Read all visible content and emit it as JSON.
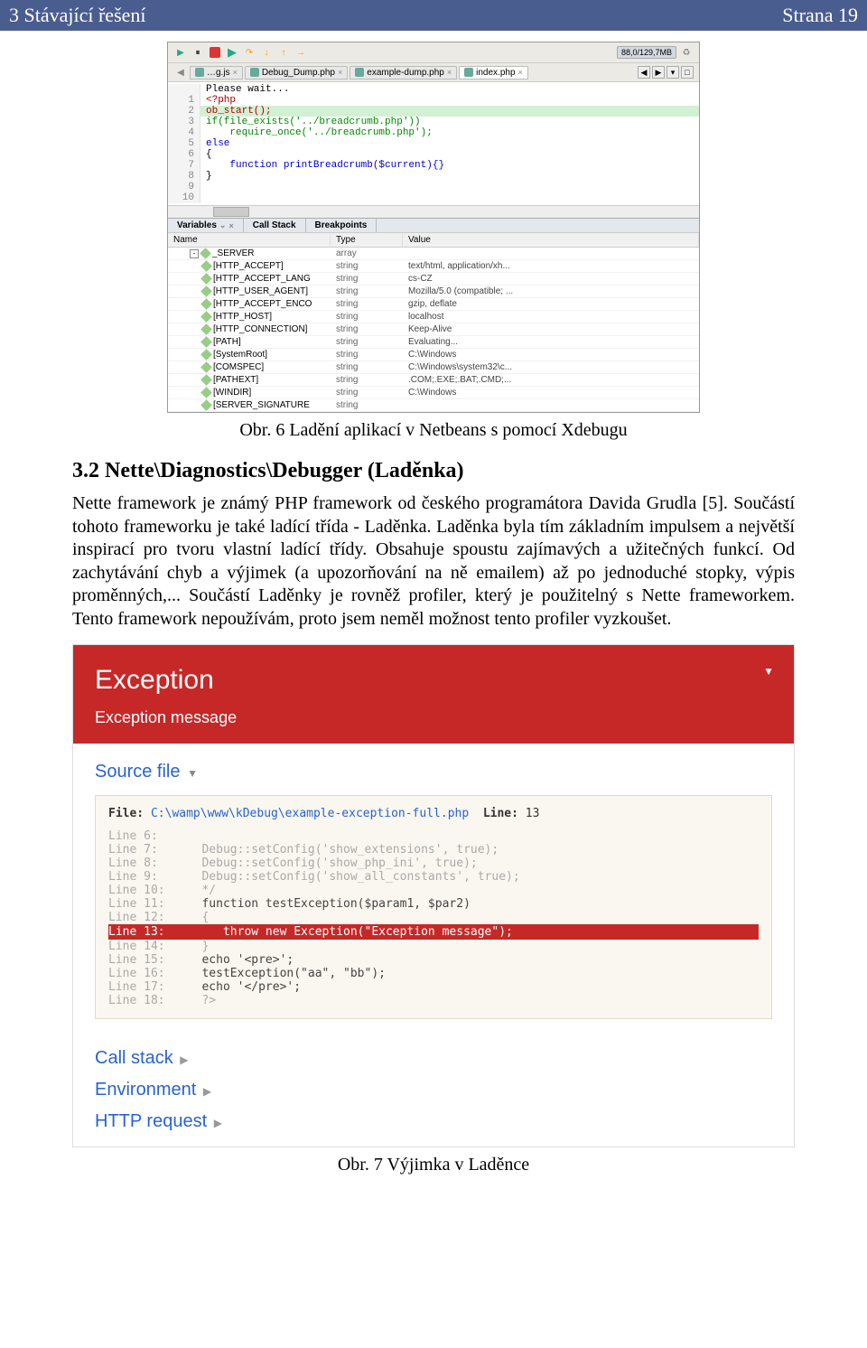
{
  "header": {
    "left": "3  Stávající řešení",
    "right": "Strana 19"
  },
  "netbeans": {
    "memory": "88,0/129,7MB",
    "tabs": [
      "…g.js",
      "Debug_Dump.php",
      "example-dump.php",
      "index.php"
    ],
    "code_lines": [
      {
        "n": "",
        "t": "Please wait..."
      },
      {
        "n": "1",
        "t": "<?php",
        "cls": "kw-red"
      },
      {
        "n": "2",
        "t": "ob_start();",
        "hl": true,
        "cls": "kw-red"
      },
      {
        "n": "3",
        "t": "if(file_exists('../breadcrumb.php'))",
        "cls": "kw-green"
      },
      {
        "n": "4",
        "t": "    require_once('../breadcrumb.php');",
        "cls": "kw-green"
      },
      {
        "n": "5",
        "t": "else",
        "cls": "kw-blue"
      },
      {
        "n": "6",
        "t": "{"
      },
      {
        "n": "7",
        "t": "    function printBreadcrumb($current){}",
        "cls": "kw-blue"
      },
      {
        "n": "8",
        "t": "}"
      },
      {
        "n": "9",
        "t": ""
      },
      {
        "n": "10",
        "t": ""
      }
    ],
    "panels": [
      "Variables",
      "Call Stack",
      "Breakpoints"
    ],
    "vars_hdr": {
      "name": "Name",
      "type": "Type",
      "value": "Value"
    },
    "vars": [
      {
        "name": "_SERVER",
        "type": "array",
        "value": "",
        "indent": 1,
        "tree": "-"
      },
      {
        "name": "[HTTP_ACCEPT]",
        "type": "string",
        "value": "text/html, application/xh...",
        "indent": 2
      },
      {
        "name": "[HTTP_ACCEPT_LANG",
        "type": "string",
        "value": "cs-CZ",
        "indent": 2
      },
      {
        "name": "[HTTP_USER_AGENT]",
        "type": "string",
        "value": "Mozilla/5.0 (compatible; ...",
        "indent": 2
      },
      {
        "name": "[HTTP_ACCEPT_ENCO",
        "type": "string",
        "value": "gzip, deflate",
        "indent": 2
      },
      {
        "name": "[HTTP_HOST]",
        "type": "string",
        "value": "localhost",
        "indent": 2
      },
      {
        "name": "[HTTP_CONNECTION]",
        "type": "string",
        "value": "Keep-Alive",
        "indent": 2
      },
      {
        "name": "[PATH]",
        "type": "string",
        "value": "Evaluating...",
        "indent": 2
      },
      {
        "name": "[SystemRoot]",
        "type": "string",
        "value": "C:\\Windows",
        "indent": 2
      },
      {
        "name": "[COMSPEC]",
        "type": "string",
        "value": "C:\\Windows\\system32\\c...",
        "indent": 2
      },
      {
        "name": "[PATHEXT]",
        "type": "string",
        "value": ".COM;.EXE;.BAT;.CMD;...",
        "indent": 2
      },
      {
        "name": "[WINDIR]",
        "type": "string",
        "value": "C:\\Windows",
        "indent": 2
      },
      {
        "name": "[SERVER_SIGNATURE",
        "type": "string",
        "value": "",
        "indent": 2
      }
    ]
  },
  "caption1": "Obr. 6 Ladění aplikací v Netbeans s pomocí Xdebugu",
  "section": {
    "num": "3.2",
    "title": "Nette\\Diagnostics\\Debugger (Laděnka)"
  },
  "paragraph": "Nette framework je známý PHP framework od českého programátora Davida Grudla [5]. Součástí tohoto frameworku je také ladící třída - Laděnka. Laděnka byla tím základním impulsem a největší inspirací pro tvoru vlastní ladící třídy. Obsahuje spoustu zajímavých a užitečných funkcí. Od zachytávání chyb a výjimek (a upozorňování na ně emailem) až po jednoduché stopky, výpis proměnných,... Součástí Laděnky je rovněž profiler, který je použitelný s Nette frameworkem. Tento framework nepoužívám, proto jsem neměl možnost tento profiler vyzkoušet.",
  "ladenka": {
    "title": "Exception",
    "message": "Exception message",
    "source_file_label": "Source file",
    "file_label": "File:",
    "file_path": "C:\\wamp\\www\\kDebug\\example-exception-full.php",
    "line_label": "Line:",
    "line_no": "13",
    "lines": [
      {
        "n": "Line  6:",
        "t": ""
      },
      {
        "n": "Line  7:",
        "t": "   Debug::setConfig('show_extensions', true);"
      },
      {
        "n": "Line  8:",
        "t": "   Debug::setConfig('show_php_ini', true);"
      },
      {
        "n": "Line  9:",
        "t": "   Debug::setConfig('show_all_constants', true);"
      },
      {
        "n": "Line 10:",
        "t": "   */"
      },
      {
        "n": "Line 11:",
        "t": "   function testException($param1, $par2)",
        "dark": true
      },
      {
        "n": "Line 12:",
        "t": "   {"
      },
      {
        "n": "Line 13:",
        "t": "      throw new Exception(\"Exception message\");",
        "hl": true
      },
      {
        "n": "Line 14:",
        "t": "   }"
      },
      {
        "n": "Line 15:",
        "t": "   echo '<pre>';",
        "dark": true
      },
      {
        "n": "Line 16:",
        "t": "   testException(\"aa\", \"bb\");",
        "dark": true
      },
      {
        "n": "Line 17:",
        "t": "   echo '</pre>';",
        "dark": true
      },
      {
        "n": "Line 18:",
        "t": "   ?>"
      }
    ],
    "links": [
      "Call stack",
      "Environment",
      "HTTP request"
    ]
  },
  "caption2": "Obr. 7 Výjimka v Laděnce"
}
